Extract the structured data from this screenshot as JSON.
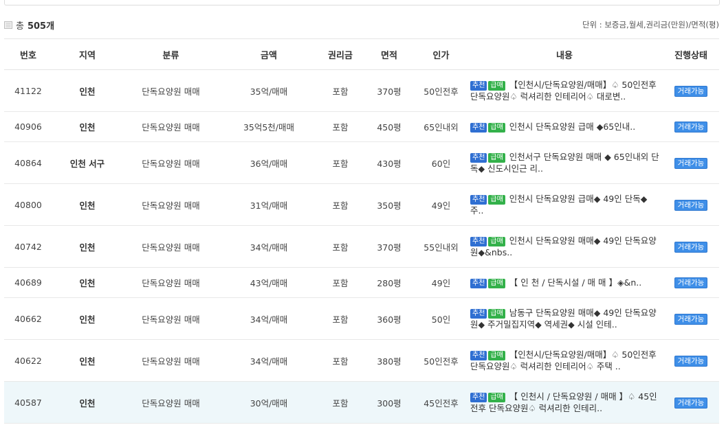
{
  "summary": {
    "count_prefix": "총",
    "count_value": "505개",
    "unit_note": "단위 : 보증금,월세,권리금(만원)/면적(평)"
  },
  "table": {
    "headers": [
      "번호",
      "지역",
      "분류",
      "금액",
      "권리금",
      "면적",
      "인가",
      "내용",
      "진행상태"
    ],
    "badges": {
      "recommend": "추천",
      "urgent": "급매"
    },
    "rows": [
      {
        "id": "41122",
        "region": "인천",
        "category": "단독요양원 매매",
        "price": "35억/매매",
        "premium": "포함",
        "area": "370평",
        "capacity": "50인전후",
        "title": "【인천시/단독요양원/매매】♤ 50인전후 단독요양원♤ 럭셔리한 인테리어♤ 대로변..",
        "status": "거래가능"
      },
      {
        "id": "40906",
        "region": "인천",
        "category": "단독요양원 매매",
        "price": "35억5천/매매",
        "premium": "포함",
        "area": "450평",
        "capacity": "65인내외",
        "title": "인천시 단독요양원 급매 ◆65인내..",
        "status": "거래가능"
      },
      {
        "id": "40864",
        "region": "인천 서구",
        "category": "단독요양원 매매",
        "price": "36억/매매",
        "premium": "포함",
        "area": "430평",
        "capacity": "60인",
        "title": "인천서구 단독요양원 매매 ◆ 65인내외 단독◆ 신도시인근 리..",
        "status": "거래가능"
      },
      {
        "id": "40800",
        "region": "인천",
        "category": "단독요양원 매매",
        "price": "31억/매매",
        "premium": "포함",
        "area": "350평",
        "capacity": "49인",
        "title": "인천시 단독요양원 급매◆ 49인 단독◆ 주..",
        "status": "거래가능"
      },
      {
        "id": "40742",
        "region": "인천",
        "category": "단독요양원 매매",
        "price": "34억/매매",
        "premium": "포함",
        "area": "370평",
        "capacity": "55인내외",
        "title": "인천시 단독요양원 매매◆ 49인 단독요양원◆&nbs..",
        "status": "거래가능"
      },
      {
        "id": "40689",
        "region": "인천",
        "category": "단독요양원 매매",
        "price": "43억/매매",
        "premium": "포함",
        "area": "280평",
        "capacity": "49인",
        "title": "【 인 천 / 단독시설 / 매 매 】◈&n..",
        "status": "거래가능"
      },
      {
        "id": "40662",
        "region": "인천",
        "category": "단독요양원 매매",
        "price": "34억/매매",
        "premium": "포함",
        "area": "360평",
        "capacity": "50인",
        "title": "남동구 단독요양원 매매◆ 49인 단독요양원◆ 주거밀집지역◆ 역세권◆ 시설 인테..",
        "status": "거래가능"
      },
      {
        "id": "40622",
        "region": "인천",
        "category": "단독요양원 매매",
        "price": "34억/매매",
        "premium": "포함",
        "area": "380평",
        "capacity": "50인전후",
        "title": "【인천시/단독요양원/매매】♤ 50인전후 단독요양원♤ 럭셔리한 인테리어♤ 주택 ..",
        "status": "거래가능"
      },
      {
        "id": "40587",
        "region": "인천",
        "category": "단독요양원 매매",
        "price": "30억/매매",
        "premium": "포함",
        "area": "300평",
        "capacity": "45인전후",
        "title": "【 인천시 / 단독요양원 / 매매 】♤ 45인전후 단독요양원♤ 럭셔리한 인테리..",
        "status": "거래가능"
      }
    ]
  }
}
